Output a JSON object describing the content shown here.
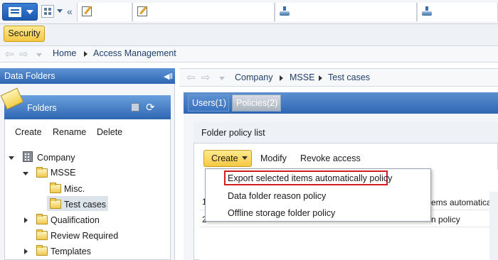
{
  "taskbar": {
    "app_menu_icon": "list-icon",
    "collapse_glyph": "«",
    "window_tabs": [
      {
        "icon": "edit-icon",
        "label": ""
      },
      {
        "icon": "edit-icon",
        "label": ""
      },
      {
        "icon": "stack-icon",
        "label": ""
      },
      {
        "icon": "stack-icon",
        "label": ""
      }
    ]
  },
  "security_button": "Security",
  "top_breadcrumb": {
    "items": [
      "Home",
      "Access Management"
    ]
  },
  "left_panel": {
    "title": "Data Folders",
    "pin_glyph": "◀‖",
    "folders_title": "Folders",
    "actions": [
      "Create",
      "Rename",
      "Delete"
    ],
    "tree": [
      {
        "label": "Company",
        "icon": "building-icon",
        "expander": "expanded"
      },
      {
        "label": "MSSE",
        "icon": "folder-icon",
        "expander": "expanded"
      },
      {
        "label": "Misc.",
        "icon": "folder-icon",
        "expander": "none"
      },
      {
        "label": "Test cases",
        "icon": "folder-icon",
        "expander": "none",
        "selected": true
      },
      {
        "label": "Qualification",
        "icon": "folder-icon",
        "expander": "collapsed"
      },
      {
        "label": "Review Required",
        "icon": "folder-icon",
        "expander": "none"
      },
      {
        "label": "Templates",
        "icon": "folder-icon",
        "expander": "collapsed"
      }
    ]
  },
  "main": {
    "breadcrumb": [
      "Company",
      "MSSE",
      "Test cases"
    ],
    "tabs": [
      {
        "label": "Users(1)",
        "active": false
      },
      {
        "label": "Policies(2)",
        "active": true
      }
    ],
    "panel_title": "Folder policy list",
    "toolbar": {
      "create": "Create",
      "modify": "Modify",
      "revoke": "Revoke access"
    },
    "grid_rows": [
      {
        "num": "1",
        "text": "ems automatically p"
      },
      {
        "num": "2",
        "text": "n policy"
      }
    ],
    "dropdown": [
      "Export selected items automatically policy",
      "Data folder reason policy",
      "Offline storage folder policy"
    ]
  },
  "colors": {
    "accent_blue": "#2f66b2",
    "button_yellow": "#f5c842",
    "highlight_red": "#d11f1f"
  }
}
